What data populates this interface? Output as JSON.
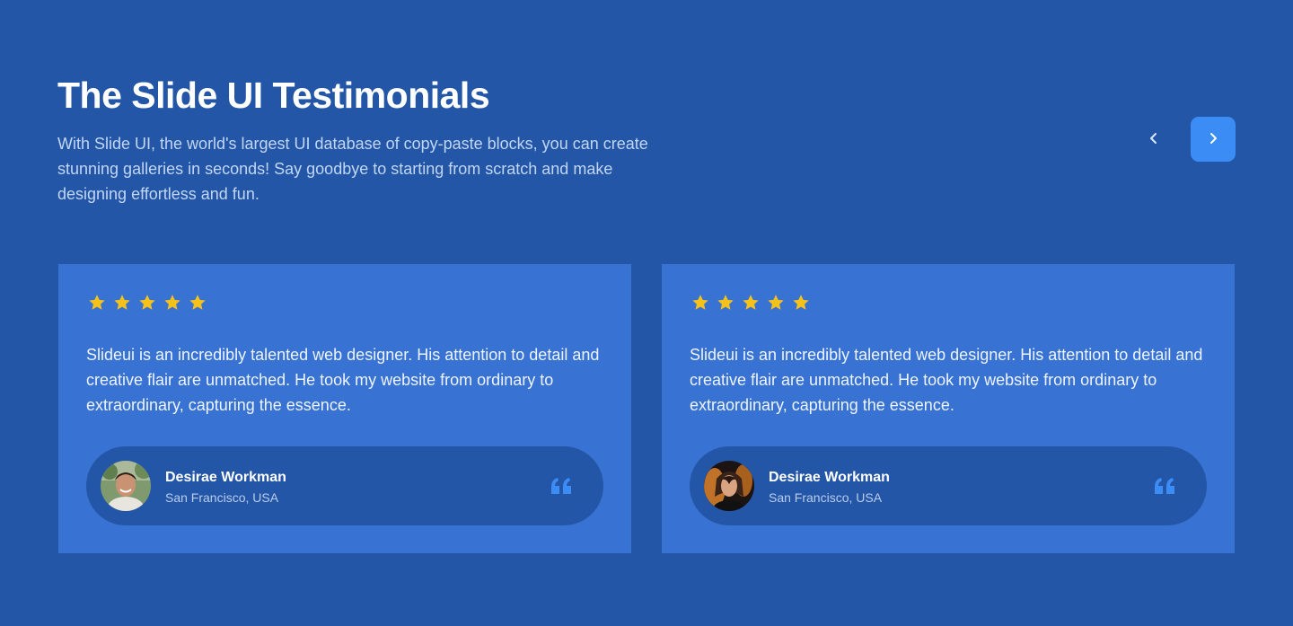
{
  "header": {
    "title": "The Slide UI Testimonials",
    "description": "With Slide UI, the world's largest UI database of copy-paste blocks, you can create stunning galleries in seconds! Say goodbye to starting from scratch and make designing effortless and fun."
  },
  "navigation": {
    "prev_icon": "chevron-left-icon",
    "next_icon": "chevron-right-icon"
  },
  "testimonials": [
    {
      "rating": 5,
      "text": "Slideui is an incredibly talented web designer. His attention to detail and creative flair are unmatched. He took my website from ordinary to extraordinary, capturing the essence.",
      "author": {
        "name": "Desirae Workman",
        "location": "San Francisco, USA"
      }
    },
    {
      "rating": 5,
      "text": "Slideui is an incredibly talented web designer. His attention to detail and creative flair are unmatched. He took my website from ordinary to extraordinary, capturing the essence.",
      "author": {
        "name": "Desirae Workman",
        "location": "San Francisco, USA"
      }
    }
  ],
  "colors": {
    "background": "#2356a6",
    "card": "#3872d2",
    "pill": "#2456a8",
    "accent": "#3b8cf5",
    "star": "#f6c21a"
  }
}
